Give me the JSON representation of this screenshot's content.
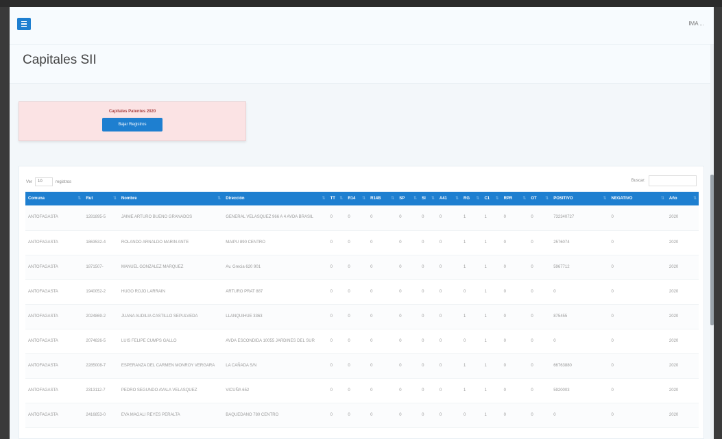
{
  "header": {
    "user_label": "IMA ..."
  },
  "page": {
    "title": "Capitales SII"
  },
  "card": {
    "title": "Capitales Patentes 2020",
    "button_label": "Bajar Registros"
  },
  "table_controls": {
    "show_label": "Ver",
    "show_value": "10",
    "records_label": "registros",
    "search_label": "Buscar:"
  },
  "table": {
    "columns": [
      "Comuna",
      "Rut",
      "Nombre",
      "Dirección",
      "TT",
      "R14",
      "R14B",
      "SP",
      "SI",
      "A41",
      "RG",
      "C1",
      "RPR",
      "OT",
      "POSITIVO",
      "NEGATIVO",
      "Año"
    ],
    "rows": [
      [
        "ANTOFAGASTA",
        "1281895-5",
        "JAIME ARTURO BUENO GRANADOS",
        "GENERAL VELASQUEZ 966 A 4 AVDA BRASIL",
        "0",
        "0",
        "0",
        "0",
        "0",
        "0",
        "1",
        "1",
        "0",
        "0",
        "732340727",
        "0",
        "2020"
      ],
      [
        "ANTOFAGASTA",
        "1863532-4",
        "ROLANDO ARNALDO MARIN ANTE",
        "MAIPU 890 CENTRO",
        "0",
        "0",
        "0",
        "0",
        "0",
        "0",
        "1",
        "1",
        "0",
        "0",
        "2576074",
        "0",
        "2020"
      ],
      [
        "ANTOFAGASTA",
        "1871507-",
        "MANUEL GONZALEZ MARQUEZ",
        "Av. Grecia 620 901",
        "0",
        "0",
        "0",
        "0",
        "0",
        "0",
        "1",
        "1",
        "0",
        "0",
        "5967712",
        "0",
        "2020"
      ],
      [
        "ANTOFAGASTA",
        "1940052-2",
        "HUGO ROJO LARRAIN",
        "ARTURO PRAT 887",
        "0",
        "0",
        "0",
        "0",
        "0",
        "0",
        "0",
        "1",
        "0",
        "0",
        "0",
        "0",
        "2020"
      ],
      [
        "ANTOFAGASTA",
        "2024869-2",
        "JUANA AUDILIA CASTILLO SEPULVEDA",
        "LLANQUIHUE 3363",
        "0",
        "0",
        "0",
        "0",
        "0",
        "0",
        "1",
        "1",
        "0",
        "0",
        "875455",
        "0",
        "2020"
      ],
      [
        "ANTOFAGASTA",
        "2074826-5",
        "LUIS FELIPE CUMPS GALLO",
        "AVDA ESCONDIDA 10055 JARDINES DEL SUR",
        "0",
        "0",
        "0",
        "0",
        "0",
        "0",
        "0",
        "1",
        "0",
        "0",
        "0",
        "0",
        "2020"
      ],
      [
        "ANTOFAGASTA",
        "2285008-7",
        "ESPERANZA DEL CARMEN MONROY VERGARA",
        "LA CAÑADA S/N",
        "0",
        "0",
        "0",
        "0",
        "0",
        "0",
        "1",
        "1",
        "0",
        "0",
        "66763880",
        "0",
        "2020"
      ],
      [
        "ANTOFAGASTA",
        "2313112-7",
        "PEDRO SEGUNDO AVALA VELASQUEZ",
        "VICUÑA 652",
        "0",
        "0",
        "0",
        "0",
        "0",
        "0",
        "1",
        "1",
        "0",
        "0",
        "5920003",
        "0",
        "2020"
      ],
      [
        "ANTOFAGASTA",
        "2416853-0",
        "EVA MAGALI REYES PERALTA",
        "BAQUEDANO 780 CENTRO",
        "0",
        "0",
        "0",
        "0",
        "0",
        "0",
        "0",
        "1",
        "0",
        "0",
        "0",
        "0",
        "2020"
      ]
    ]
  },
  "colors": {
    "brand_blue": "#1e7fd0",
    "card_bg": "#fbe3e4"
  }
}
